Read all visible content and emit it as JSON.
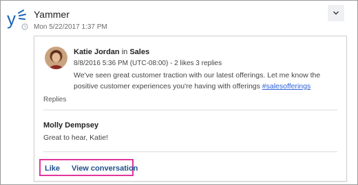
{
  "header": {
    "app_name": "Yammer",
    "timestamp": "Mon 5/22/2017 1:37 PM"
  },
  "post": {
    "author": "Katie Jordan",
    "in_word": "in",
    "group": "Sales",
    "meta": "8/8/2016 5:36 PM (UTC-08:00) - 2 likes 3 replies",
    "body": "We've seen great customer traction with our latest offerings. Let me know the positive customer experiences you're having with offerings",
    "hashtag": "#salesofferings"
  },
  "replies": {
    "label": "Replies",
    "items": [
      {
        "author": "Molly Dempsey",
        "text": "Great to hear, Katie!"
      }
    ]
  },
  "actions": {
    "like": "Like",
    "view_conversation": "View conversation"
  },
  "colors": {
    "brand_blue": "#1a64b8",
    "link": "#1f4f8c",
    "hashtag": "#2b5fd9",
    "highlight": "#e0359b"
  },
  "icons": {
    "logo": "yammer-logo",
    "expand": "chevron-down-icon"
  }
}
